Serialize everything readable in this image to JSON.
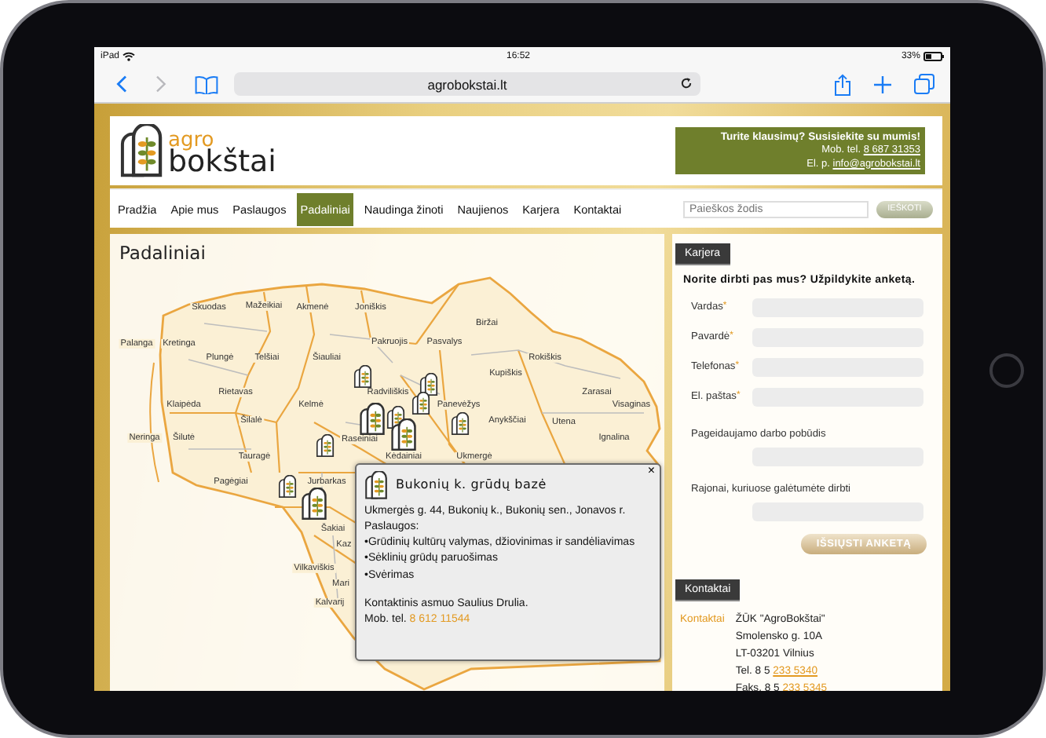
{
  "status_bar": {
    "device": "iPad",
    "time": "16:52",
    "battery": "33%"
  },
  "browser": {
    "url": "agrobokstai.lt"
  },
  "logo": {
    "prefix": "agro",
    "name": "bokštai"
  },
  "contact_box": {
    "heading": "Turite klausimų? Susisiekite su mumis!",
    "phone_label": "Mob. tel.",
    "phone": "8 687 31353",
    "email_label": "El. p.",
    "email": "info@agrobokstai.lt"
  },
  "nav": [
    {
      "label": "Pradžia",
      "selected": false
    },
    {
      "label": "Apie mus",
      "selected": false
    },
    {
      "label": "Paslaugos",
      "selected": false
    },
    {
      "label": "Padaliniai",
      "selected": true
    },
    {
      "label": "Naudinga žinoti",
      "selected": false
    },
    {
      "label": "Naujienos",
      "selected": false
    },
    {
      "label": "Karjera",
      "selected": false
    },
    {
      "label": "Kontaktai",
      "selected": false
    }
  ],
  "search": {
    "placeholder": "Paieškos žodis",
    "button": "IEŠKOTI"
  },
  "map_panel": {
    "title": "Padaliniai",
    "districts": [
      "Skuodas",
      "Mažeikiai",
      "Akmenė",
      "Joniškis",
      "Biržai",
      "Palanga",
      "Kretinga",
      "Pakruojis",
      "Pasvalys",
      "Plungė",
      "Telšiai",
      "Šiauliai",
      "Rokiškis",
      "Kupiškis",
      "Rietavas",
      "Radviliškis",
      "Zarasai",
      "Klaipėda",
      "Kelmė",
      "Panevėžys",
      "Visaginas",
      "Šilalė",
      "Anykščiai",
      "Utena",
      "Neringa",
      "Šilutė",
      "Raseiniai",
      "Ignalina",
      "Tauragė",
      "Kėdainiai",
      "Ukmergė",
      "Pagėgiai",
      "Jurbarkas",
      "Šakiai",
      "Kaz",
      "Vilkaviškis",
      "Mari",
      "Kalvarij"
    ],
    "popup": {
      "title": "Bukonių k. grūdų bazė",
      "close": "×",
      "lines": [
        "Ukmergės g. 44, Bukonių k., Bukonių sen.,  Jonavos r.",
        "Paslaugos:",
        "•Grūdinių kultūrų valymas, džiovinimas ir sandėliavimas",
        "•Sėklinių grūdų paruošimas",
        "•Svėrimas"
      ],
      "contact": "Kontaktinis asmuo Saulius Drulia.",
      "phone_label": "Mob. tel.",
      "phone": "8 612 11544"
    }
  },
  "career": {
    "title": "Karjera",
    "intro": "Norite dirbti pas mus? Užpildykite anketą.",
    "fields": [
      {
        "label": "Vardas",
        "kind": "inline",
        "required_mark": "*"
      },
      {
        "label": "Pavardė",
        "kind": "inline",
        "required_mark": "*"
      },
      {
        "label": "Telefonas",
        "kind": "inline",
        "required_mark": "*"
      },
      {
        "label": "El. paštas",
        "kind": "inline",
        "required_mark": "*"
      },
      {
        "label": "Pageidaujamo darbo pobūdis",
        "kind": "stacked"
      },
      {
        "label": "Rajonai, kuriuose galėtumėte dirbti",
        "kind": "stacked"
      }
    ],
    "button": "IŠSIŲSTI ANKETĄ"
  },
  "contacts": {
    "title": "Kontaktai",
    "label": "Kontaktai",
    "lines": [
      "ŽŪK \"AgroBokštai\"",
      "Smolensko g. 10A",
      "LT-03201 Vilnius"
    ],
    "phone_label": "Tel. 8 5",
    "phone": "233 5340",
    "fax_label": "Faks. 8 5",
    "fax": "233 5345"
  }
}
